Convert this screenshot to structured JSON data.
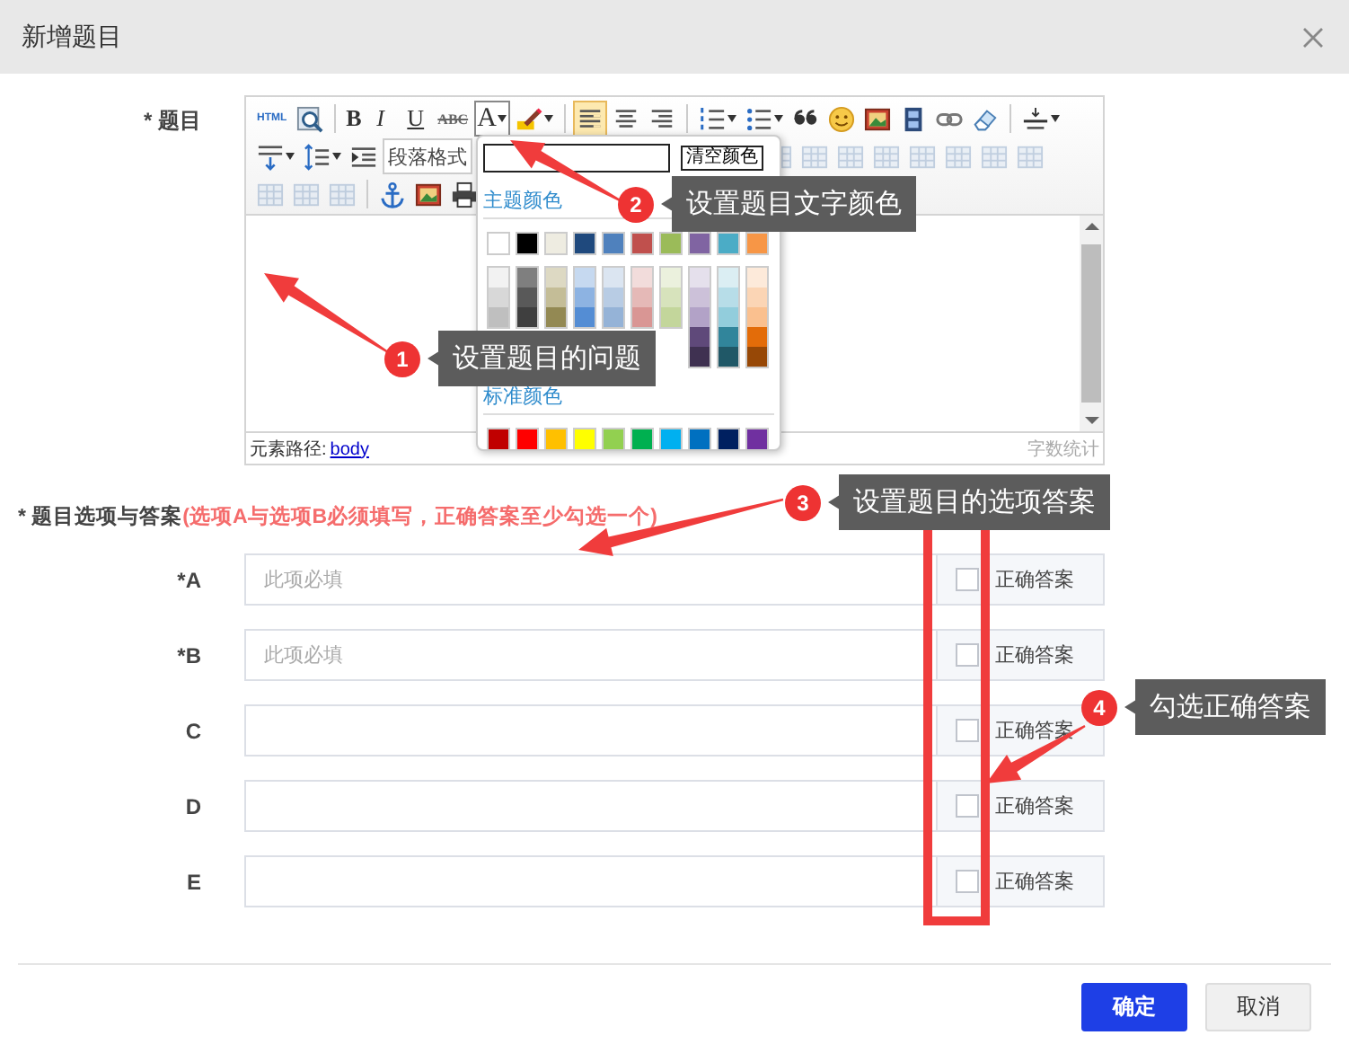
{
  "dialog": {
    "title": "新增题目"
  },
  "question": {
    "label": "* 题目",
    "toolbar_rows": [
      [
        {
          "kind": "html",
          "label": "HTML",
          "active": false
        },
        {
          "kind": "preview",
          "active": false
        },
        {
          "kind": "sep"
        },
        {
          "kind": "bold",
          "label": "B",
          "active": false
        },
        {
          "kind": "italic",
          "label": "I",
          "active": false
        },
        {
          "kind": "underline",
          "label": "U",
          "active": false
        },
        {
          "kind": "strike",
          "label": "ABC",
          "active": false
        },
        {
          "kind": "fontcolor",
          "label": "A",
          "active": true,
          "dropdown": true
        },
        {
          "kind": "highlight",
          "active": false,
          "dropdown": true
        },
        {
          "kind": "sep"
        },
        {
          "kind": "align-left",
          "active": true
        },
        {
          "kind": "align-center",
          "active": false
        },
        {
          "kind": "align-right",
          "active": false
        },
        {
          "kind": "sep"
        },
        {
          "kind": "ol",
          "active": false,
          "dropdown": true
        },
        {
          "kind": "ul",
          "active": false,
          "dropdown": true
        },
        {
          "kind": "quote",
          "active": false
        },
        {
          "kind": "emoji",
          "active": false
        },
        {
          "kind": "image",
          "active": false
        },
        {
          "kind": "video",
          "active": false
        },
        {
          "kind": "link",
          "active": false
        },
        {
          "kind": "eraser",
          "active": false
        },
        {
          "kind": "sep"
        },
        {
          "kind": "hr",
          "active": false,
          "dropdown": true
        }
      ],
      [
        {
          "kind": "para-spacing",
          "disabled": false,
          "dropdown": true
        },
        {
          "kind": "line-height",
          "disabled": false,
          "dropdown": true
        },
        {
          "kind": "indent",
          "disabled": false
        },
        {
          "kind": "select",
          "label": "段落格式",
          "disabled": false
        },
        {
          "kind": "table-tool",
          "disabled": true
        },
        {
          "kind": "table-tool",
          "disabled": true
        },
        {
          "kind": "table-tool",
          "disabled": true
        },
        {
          "kind": "table-tool",
          "disabled": true
        },
        {
          "kind": "table-tool",
          "disabled": true
        },
        {
          "kind": "table-tool",
          "disabled": true
        },
        {
          "kind": "table-tool",
          "disabled": true
        },
        {
          "kind": "table-tool",
          "disabled": true
        }
      ],
      [
        {
          "kind": "table-tool",
          "disabled": true
        },
        {
          "kind": "table-tool",
          "disabled": true
        },
        {
          "kind": "table-tool",
          "disabled": true
        },
        {
          "kind": "sep"
        },
        {
          "kind": "anchor",
          "disabled": false
        },
        {
          "kind": "image",
          "disabled": false
        },
        {
          "kind": "print",
          "disabled": false
        }
      ]
    ],
    "color_popup": {
      "clear_button": "清空颜色",
      "theme_title": "主题颜色",
      "theme_colors": [
        {
          "color": "#ffffff"
        },
        {
          "color": "#000000"
        },
        {
          "color": "#eeece1"
        },
        {
          "color": "#1f497d"
        },
        {
          "color": "#4f81bd"
        },
        {
          "color": "#c0504d"
        },
        {
          "color": "#9bbb59"
        },
        {
          "color": "#8064a2"
        },
        {
          "color": "#4bacc6"
        },
        {
          "color": "#f79646"
        }
      ],
      "shades": [
        [
          {
            "color": "#f2f2f2"
          },
          {
            "color": "#d8d8d8"
          },
          {
            "color": "#bfbfbf"
          }
        ],
        [
          {
            "color": "#7f7f7f"
          },
          {
            "color": "#595959"
          },
          {
            "color": "#3f3f3f"
          }
        ],
        [
          {
            "color": "#ddd9c3"
          },
          {
            "color": "#c4bd97"
          },
          {
            "color": "#938953"
          }
        ],
        [
          {
            "color": "#c6d9f0"
          },
          {
            "color": "#8db3e2"
          },
          {
            "color": "#548dd4"
          }
        ],
        [
          {
            "color": "#dbe5f1"
          },
          {
            "color": "#b8cce4"
          },
          {
            "color": "#95b3d7"
          }
        ],
        [
          {
            "color": "#f2dcdb"
          },
          {
            "color": "#e5b9b7"
          },
          {
            "color": "#d99694"
          }
        ],
        [
          {
            "color": "#ebf1dd"
          },
          {
            "color": "#d7e3bc"
          },
          {
            "color": "#c3d69b"
          }
        ],
        [
          {
            "color": "#e5e0ec"
          },
          {
            "color": "#ccc1d9"
          },
          {
            "color": "#b2a2c7"
          },
          {
            "color": "#5f497a"
          },
          {
            "color": "#3f3151"
          }
        ],
        [
          {
            "color": "#dbeef3"
          },
          {
            "color": "#b7dde8"
          },
          {
            "color": "#92cddc"
          },
          {
            "color": "#31859b"
          },
          {
            "color": "#205867"
          }
        ],
        [
          {
            "color": "#fdeada"
          },
          {
            "color": "#fbd5b5"
          },
          {
            "color": "#fac08f"
          },
          {
            "color": "#e36c09"
          },
          {
            "color": "#974806"
          }
        ]
      ],
      "standard_title": "标准颜色",
      "standard_colors": [
        {
          "color": "#c00000"
        },
        {
          "color": "#ff0000"
        },
        {
          "color": "#ffc000"
        },
        {
          "color": "#ffff00"
        },
        {
          "color": "#92d050"
        },
        {
          "color": "#00b050"
        },
        {
          "color": "#00b0f0"
        },
        {
          "color": "#0070c0"
        },
        {
          "color": "#002060"
        },
        {
          "color": "#7030a0"
        }
      ]
    },
    "footer": {
      "path_label": "元素路径:",
      "path_link": "body",
      "word_count": "字数统计"
    }
  },
  "options": {
    "label": "* 题目选项与答案",
    "hint": "(选项A与选项B必须填写，正确答案至少勾选一个)",
    "rows": [
      {
        "label": "*A",
        "placeholder": "此项必填",
        "checked": false,
        "answer_label": "正确答案"
      },
      {
        "label": "*B",
        "placeholder": "此项必填",
        "checked": false,
        "answer_label": "正确答案"
      },
      {
        "label": "C",
        "checked": false,
        "answer_label": "正确答案"
      },
      {
        "label": "D",
        "checked": false,
        "answer_label": "正确答案"
      },
      {
        "label": "E",
        "checked": false,
        "answer_label": "正确答案"
      }
    ]
  },
  "buttons": [
    {
      "label": "确定",
      "kind": "primary"
    },
    {
      "label": "取消",
      "kind": "default"
    }
  ],
  "annotations": [
    {
      "number": "1",
      "text": "设置题目的问题"
    },
    {
      "number": "2",
      "text": "设置题目文字颜色"
    },
    {
      "number": "3",
      "text": "设置题目的选项答案"
    },
    {
      "number": "4",
      "text": "勾选正确答案"
    }
  ]
}
